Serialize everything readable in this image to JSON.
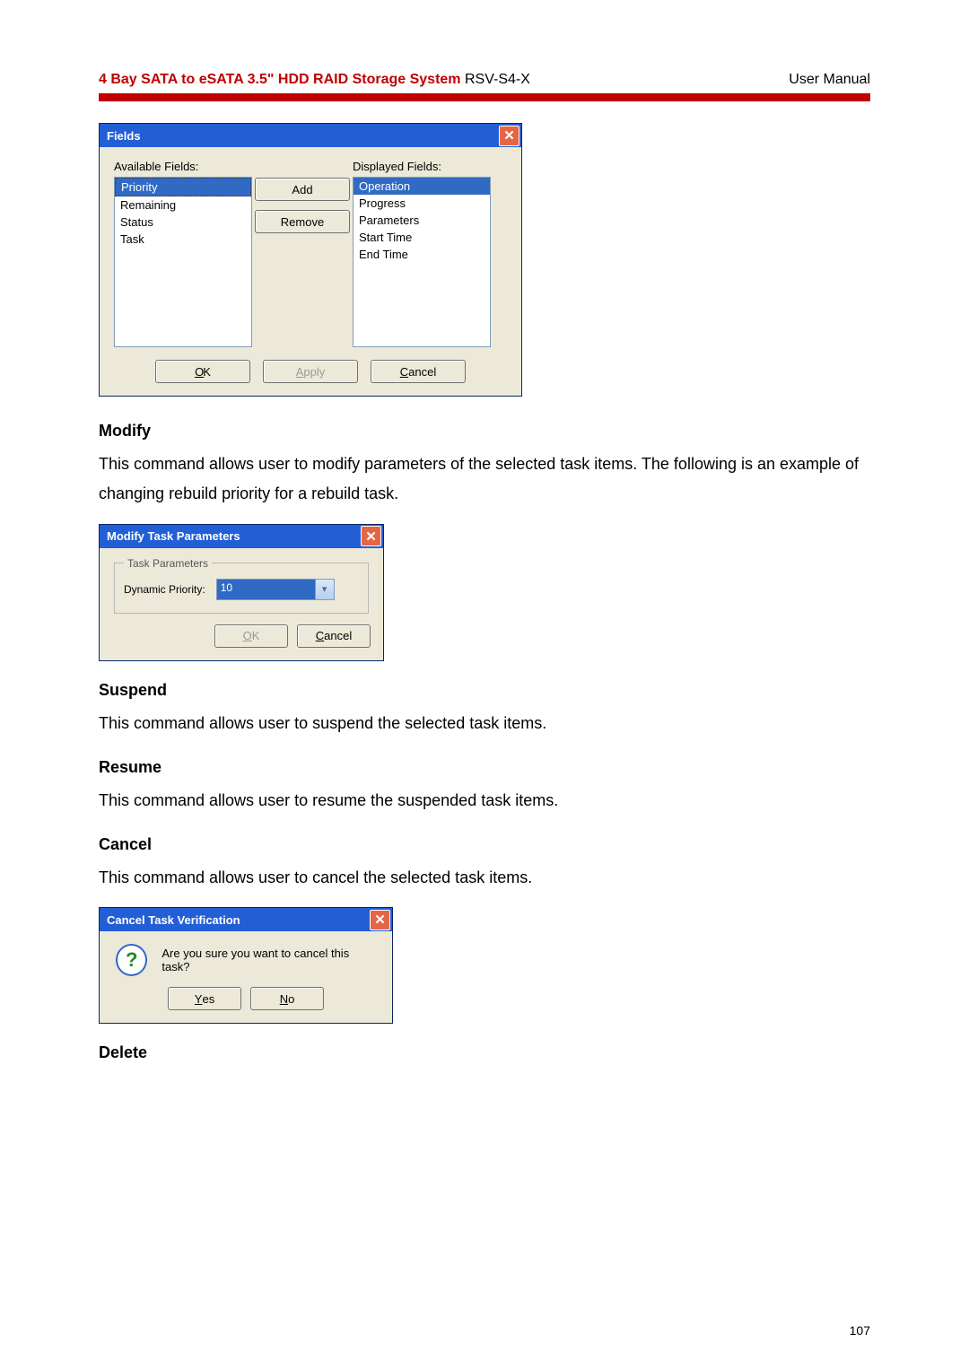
{
  "header": {
    "title_bold": "4 Bay SATA to eSATA 3.5\" HDD RAID Storage System ",
    "model": "RSV-S4-X",
    "right": "User Manual"
  },
  "fields_dialog": {
    "title": "Fields",
    "available_label": "Available Fields:",
    "displayed_label": "Displayed Fields:",
    "available": [
      "Priority",
      "Remaining",
      "Status",
      "Task"
    ],
    "displayed": [
      "Operation",
      "Progress",
      "Parameters",
      "Start Time",
      "End Time"
    ],
    "add": "Add",
    "remove": "Remove",
    "ok": "OK",
    "apply": "Apply",
    "cancel": "Cancel"
  },
  "modify": {
    "heading": "Modify",
    "text": "This command allows user to modify parameters of the selected task items.  The following is an example of changing rebuild priority for a rebuild task.",
    "dlg_title": "Modify Task Parameters",
    "group": "Task Parameters",
    "dp_label": "Dynamic Priority:",
    "dp_value": "10",
    "ok": "OK",
    "cancel": "Cancel"
  },
  "suspend": {
    "heading": "Suspend",
    "text": "This command allows user to suspend the selected task items."
  },
  "resume": {
    "heading": "Resume",
    "text": "This command allows user to resume the suspended task items."
  },
  "cancel_sec": {
    "heading": "Cancel",
    "text": "This command allows user to cancel the selected task items.",
    "dlg_title": "Cancel Task Verification",
    "msg": "Are you sure you want to cancel this task?",
    "yes": "Yes",
    "no": "No"
  },
  "delete": {
    "heading": "Delete"
  },
  "page_number": "107"
}
